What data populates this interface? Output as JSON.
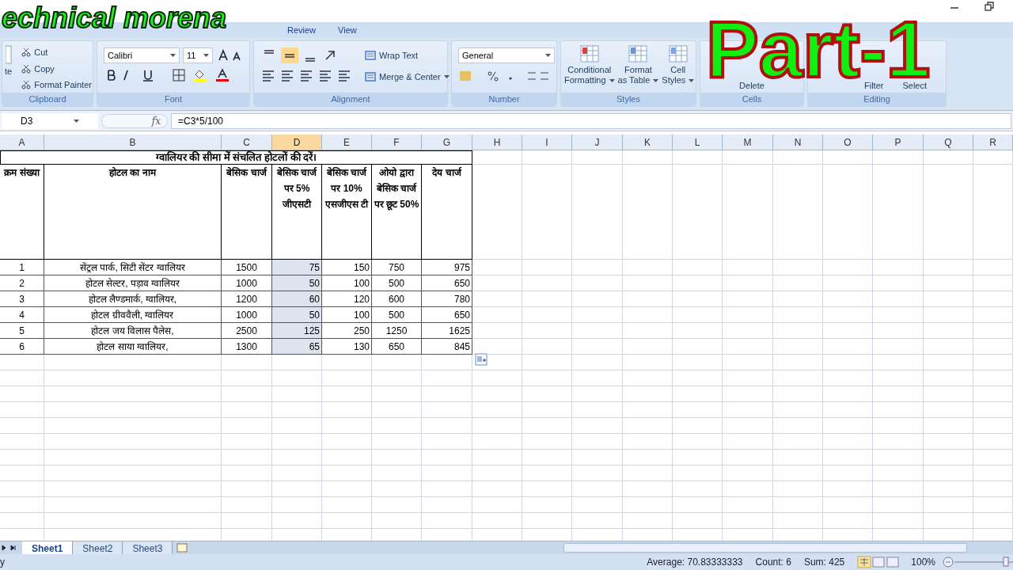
{
  "overlays": {
    "channel": "echnical morena",
    "part": "Part-1"
  },
  "ribbon_tabs": [
    {
      "label": "Review",
      "selected": false
    },
    {
      "label": "View",
      "selected": false
    }
  ],
  "clipboard": {
    "paste_fragment": "te",
    "items": [
      "Cut",
      "Copy",
      "Format Painter"
    ],
    "label": "Clipboard"
  },
  "font": {
    "name": "Calibri",
    "size": "11",
    "label": "Font"
  },
  "alignment": {
    "wrap": "Wrap Text",
    "merge": "Merge & Center",
    "label": "Alignment",
    "middle_align_on": true
  },
  "number": {
    "format": "General",
    "label": "Number"
  },
  "styles": {
    "items": [
      {
        "lines": [
          "Conditional",
          "Formatting"
        ]
      },
      {
        "lines": [
          "Format",
          "as Table"
        ]
      },
      {
        "lines": [
          "Cell",
          "Styles"
        ]
      }
    ],
    "label": "Styles"
  },
  "cells": {
    "items": [
      "Delete"
    ],
    "label": "Cells"
  },
  "editing": {
    "items": [
      "Filter",
      "Select"
    ],
    "label": "Editing"
  },
  "formula_bar": {
    "name_box": "D3",
    "function_label": "fx",
    "formula": "=C3*5/100"
  },
  "columns": [
    {
      "label": "A",
      "selected": false
    },
    {
      "label": "B",
      "selected": false
    },
    {
      "label": "C",
      "selected": false
    },
    {
      "label": "D",
      "selected": true
    },
    {
      "label": "E",
      "selected": false
    },
    {
      "label": "F",
      "selected": false
    },
    {
      "label": "G",
      "selected": false
    },
    {
      "label": "H",
      "selected": false
    },
    {
      "label": "I",
      "selected": false
    },
    {
      "label": "J",
      "selected": false
    },
    {
      "label": "K",
      "selected": false
    },
    {
      "label": "L",
      "selected": false
    },
    {
      "label": "M",
      "selected": false
    },
    {
      "label": "N",
      "selected": false
    },
    {
      "label": "O",
      "selected": false
    },
    {
      "label": "P",
      "selected": false
    },
    {
      "label": "Q",
      "selected": false
    },
    {
      "label": "R",
      "selected": false
    }
  ],
  "table": {
    "title": "ग्वालियर की सीमा में संचलित होटलों की दरें।",
    "headers": [
      "क्रम संख्या",
      "होटल का नाम",
      "बेसिक चार्ज",
      "बेसिक चार्ज पर 5% जीएसटी",
      "बेसिक चार्ज पर 10% एसजीएस टी",
      "ओयो द्वारा बेसिक चार्ज पर छूट 50%",
      "देय चार्ज"
    ],
    "rows": [
      [
        "1",
        "सेंट्रल पार्क, सिटी सेंटर ग्वालियर",
        "1500",
        "75",
        "150",
        "750",
        "975"
      ],
      [
        "2",
        "होटल सेल्टर, पड़ाव ग्वालियर",
        "1000",
        "50",
        "100",
        "500",
        "650"
      ],
      [
        "3",
        "होटल लैण्डमार्क, ग्वालियर,",
        "1200",
        "60",
        "120",
        "600",
        "780"
      ],
      [
        "4",
        "होटल ग्रीववैली, ग्वालियर",
        "1000",
        "50",
        "100",
        "500",
        "650"
      ],
      [
        "5",
        "होटल जय विलास पैलेस,",
        "2500",
        "125",
        "250",
        "1250",
        "1625"
      ],
      [
        "6",
        "होटल साया ग्वालियर,",
        "1300",
        "65",
        "130",
        "650",
        "845"
      ]
    ]
  },
  "sheet_tabs": [
    {
      "label": "Sheet1",
      "selected": true
    },
    {
      "label": "Sheet2",
      "selected": false
    },
    {
      "label": "Sheet3",
      "selected": false
    }
  ],
  "status_bar": {
    "mode_fragment": "y",
    "stats": [
      "Average: 70.83333333",
      "Count: 6",
      "Sum: 425"
    ],
    "zoom": "100%"
  }
}
